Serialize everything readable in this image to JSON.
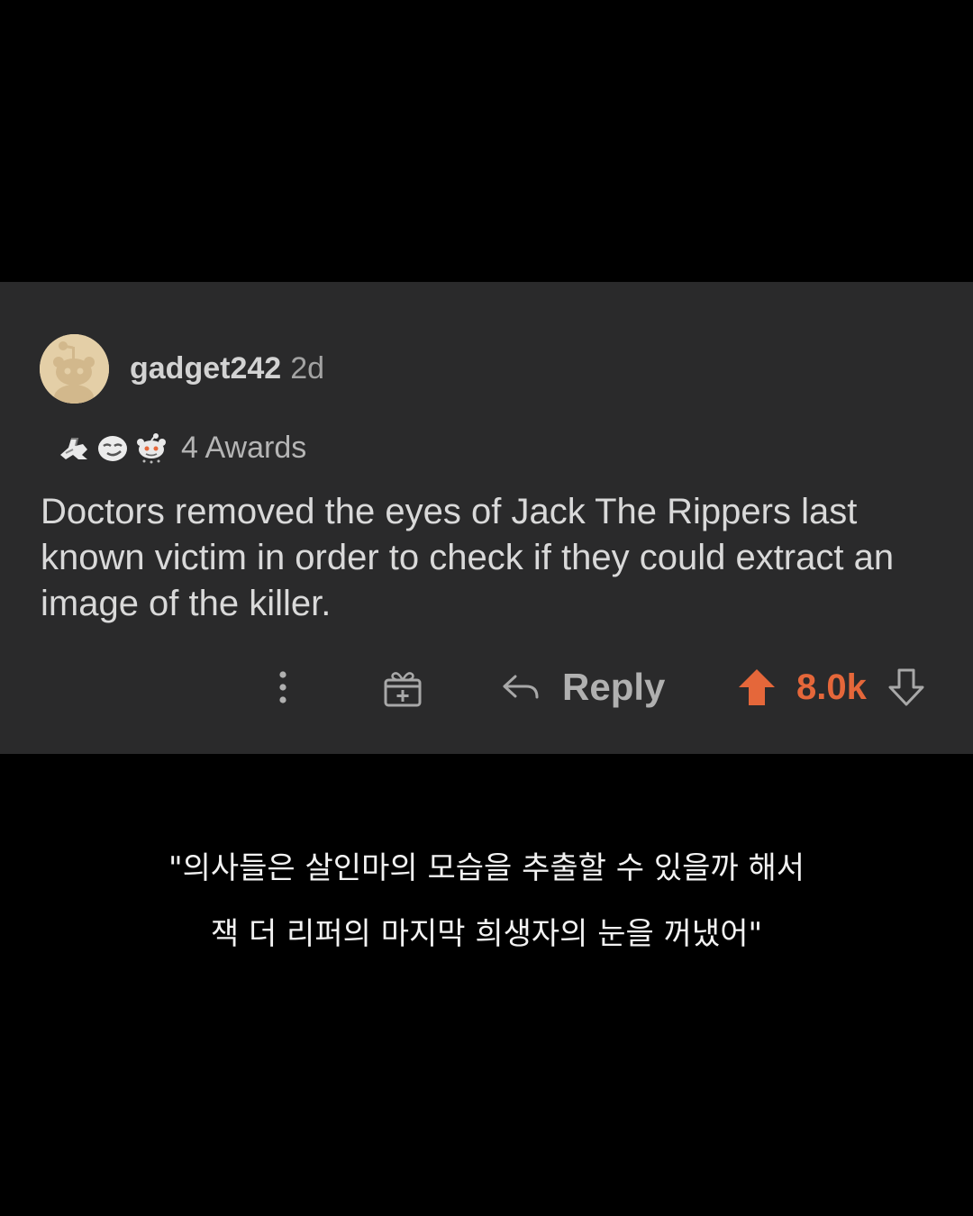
{
  "comment": {
    "username": "gadget242",
    "age": "2d",
    "awards": {
      "icons": [
        "arm-wrestling-award-icon",
        "smirk-award-icon",
        "snoo-award-icon"
      ],
      "count_label": "4 Awards"
    },
    "body": "Doctors removed the eyes of Jack The Rippers last known victim in order to check if they could extract an image of the killer.",
    "actions": {
      "reply_label": "Reply",
      "score": "8.0k",
      "upvoted": true
    }
  },
  "caption": {
    "line1": "\"의사들은 살인마의 모습을 추출할 수 있을까 해서",
    "line2": "잭 더 리퍼의 마지막 희생자의 눈을 꺼냈어\""
  },
  "colors": {
    "page_background": "#000000",
    "card_background": "#2a2a2b",
    "upvote_accent": "#e5673a",
    "text_primary": "#d9d9d9",
    "text_muted": "#a3a3a3",
    "avatar_background": "#e4cfa7"
  }
}
